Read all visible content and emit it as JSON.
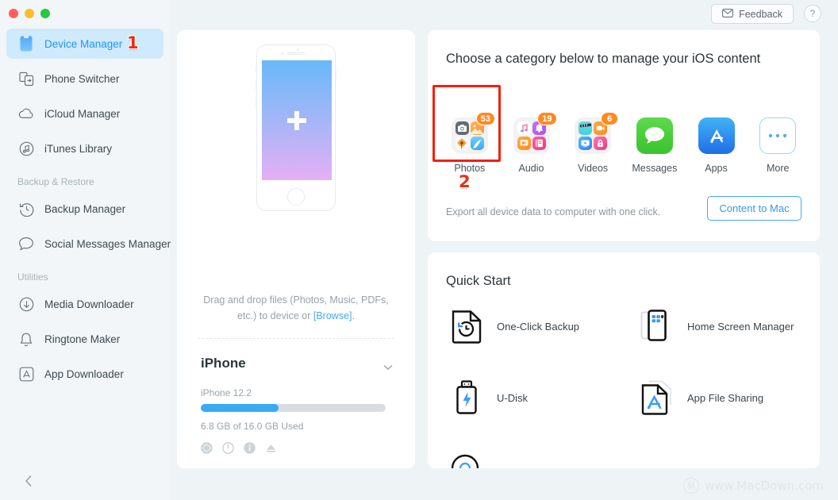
{
  "window": {
    "traffic_lights": [
      "close",
      "minimize",
      "maximize"
    ]
  },
  "header": {
    "feedback_label": "Feedback",
    "feedback_icon": "envelope-icon",
    "help_label": "?"
  },
  "sidebar": {
    "items": [
      {
        "label": "Device Manager",
        "icon": "device-icon",
        "active": true
      },
      {
        "label": "Phone Switcher",
        "icon": "phone-switcher-icon",
        "active": false
      },
      {
        "label": "iCloud Manager",
        "icon": "cloud-icon",
        "active": false
      },
      {
        "label": "iTunes Library",
        "icon": "music-note-icon",
        "active": false
      }
    ],
    "group_backup_label": "Backup & Restore",
    "backup_items": [
      {
        "label": "Backup Manager",
        "icon": "clock-restore-icon"
      },
      {
        "label": "Social Messages Manager",
        "icon": "chat-bubble-icon"
      }
    ],
    "group_utilities_label": "Utilities",
    "utility_items": [
      {
        "label": "Media Downloader",
        "icon": "download-circle-icon"
      },
      {
        "label": "Ringtone Maker",
        "icon": "bell-icon"
      },
      {
        "label": "App Downloader",
        "icon": "appstore-square-icon"
      }
    ],
    "collapse_icon": "chevron-left-icon"
  },
  "annotations": {
    "step1": "1",
    "step2": "2",
    "highlight_color": "#f61f0c",
    "step_color": "#ee2b10"
  },
  "device_panel": {
    "phone_illustration": "iphone-dropzone-illustration",
    "plus_icon": "plus-icon",
    "drag_text_1": "Drag and drop files (Photos, Music, PDFs,",
    "drag_text_2": "etc.) to device or ",
    "browse_link": "[Browse]",
    "drag_text_3": ".",
    "device_name": "iPhone",
    "chevron_icon": "chevron-down-icon",
    "os_version": "iPhone 12.2",
    "storage_used_label": "6.8 GB of  16.0 GB Used",
    "storage_used_gb": 6.8,
    "storage_total_gb": 16.0,
    "storage_percent": 42,
    "action_icons": [
      "snowflake-icon",
      "power-icon",
      "info-icon",
      "eject-icon"
    ]
  },
  "category_card": {
    "title": "Choose a category below to manage your iOS content",
    "categories": [
      {
        "label": "Photos",
        "badge": "53",
        "icon": "photos-folder-icon",
        "selected": true
      },
      {
        "label": "Audio",
        "badge": "19",
        "icon": "audio-folder-icon",
        "selected": false
      },
      {
        "label": "Videos",
        "badge": "6",
        "icon": "videos-folder-icon",
        "selected": false
      },
      {
        "label": "Messages",
        "badge": "",
        "icon": "messages-icon",
        "selected": false
      },
      {
        "label": "Apps",
        "badge": "",
        "icon": "appstore-icon",
        "selected": false
      },
      {
        "label": "More",
        "badge": "",
        "icon": "more-ellipsis-icon",
        "selected": false
      }
    ],
    "export_text": "Export all device data to computer with one click.",
    "content_button_label": "Content to Mac",
    "accent_color": "#3399f1",
    "badge_color": "#ff8a1e"
  },
  "quick_start": {
    "title": "Quick Start",
    "items": [
      {
        "label": "One-Click Backup",
        "icon": "backup-file-icon"
      },
      {
        "label": "Home Screen Manager",
        "icon": "home-screen-icon"
      },
      {
        "label": "U-Disk",
        "icon": "usb-drive-icon"
      },
      {
        "label": "App File Sharing",
        "icon": "app-file-icon"
      }
    ]
  },
  "watermark": {
    "text": "www.MacDown.com",
    "logo": "macdown-logo-icon"
  }
}
